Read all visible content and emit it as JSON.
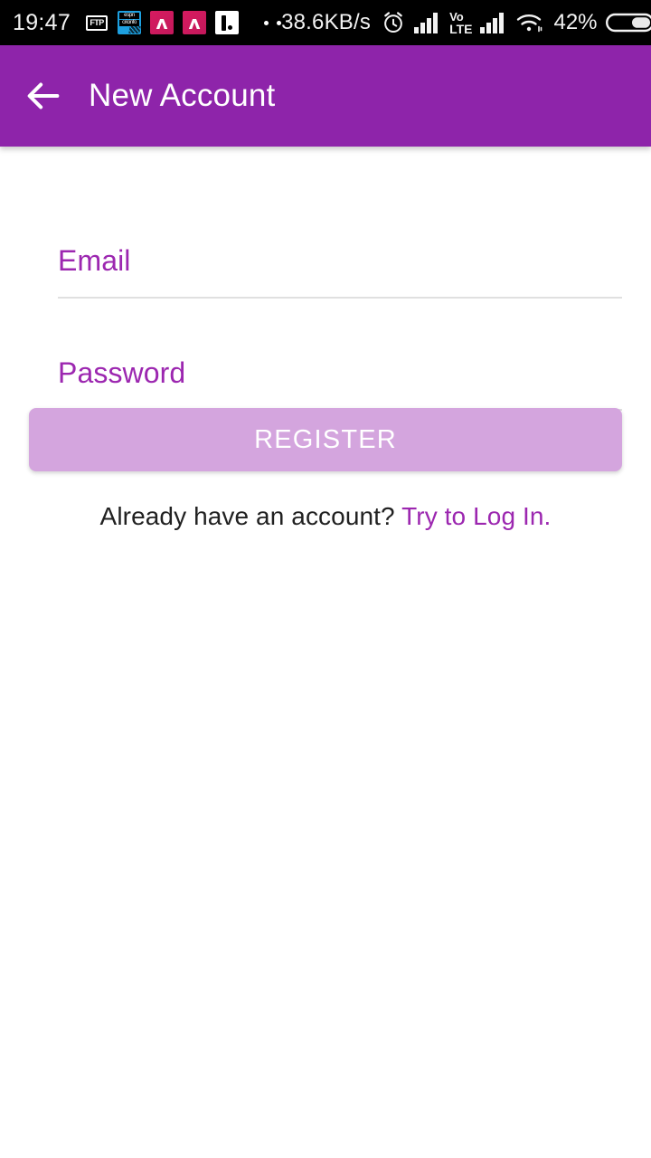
{
  "status_bar": {
    "clock": "19:47",
    "network_speed": "38.6KB/s",
    "battery_percent": "42%",
    "notification_icons": [
      {
        "name": "ftp-icon",
        "label": "FTP"
      },
      {
        "name": "espn-cricinfo-icon",
        "label_top": "espn",
        "label_bottom": "cricinfo"
      },
      {
        "name": "acrobat-icon-1",
        "label": "ʌ"
      },
      {
        "name": "acrobat-icon-2",
        "label": "ʌ"
      },
      {
        "name": "bar-note-icon",
        "label": ""
      }
    ],
    "overflow_dots": 2,
    "system_icons": [
      "alarm-icon",
      "signal-bars-sim1-icon",
      "volte-icon",
      "signal-bars-sim2-icon",
      "wifi-icon",
      "battery-icon"
    ],
    "volte_top": "Vo",
    "volte_bottom": "LTE"
  },
  "app_bar": {
    "back_label": "back-arrow",
    "title": "New Account",
    "background_color": "#8e24aa",
    "title_color": "#ffffff"
  },
  "form": {
    "email": {
      "label": "Email",
      "value": "",
      "placeholder": ""
    },
    "password": {
      "label": "Password",
      "value": "",
      "placeholder": ""
    },
    "register_button": {
      "label": "REGISTER",
      "enabled": false,
      "background_color": "#d4a5de",
      "text_color": "#ffffff"
    },
    "login_prompt": {
      "text": "Already have an account?",
      "link_text": "Try to Log In.",
      "link_color": "#9c27b0"
    },
    "accent_color": "#9c27b0",
    "underline_color": "#e0e0e0"
  }
}
